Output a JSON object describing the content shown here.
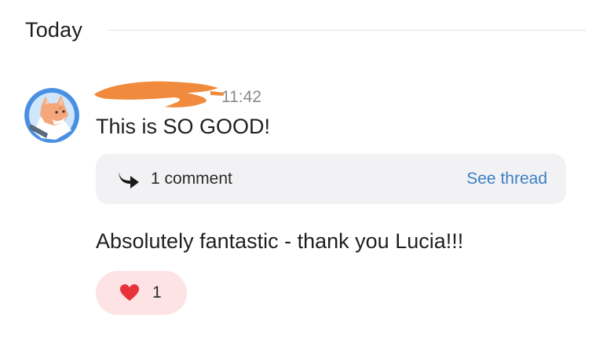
{
  "date_divider": {
    "label": "Today"
  },
  "message": {
    "author_redacted": true,
    "time": "11:42",
    "text": "This is SO GOOD!",
    "thread": {
      "count_label": "1 comment",
      "link_label": "See thread",
      "icon": "reply-arrow-icon"
    }
  },
  "message_2": {
    "text": "Absolutely fantastic - thank you Lucia!!!",
    "reaction": {
      "icon": "heart-icon",
      "count": "1"
    }
  },
  "colors": {
    "link": "#3c7fc6",
    "thread_bg": "#f2f2f4",
    "reaction_bg": "#fde3e3",
    "heart": "#e8323c",
    "redaction": "#f08a3c",
    "avatar_bg": "#4a90e2"
  }
}
